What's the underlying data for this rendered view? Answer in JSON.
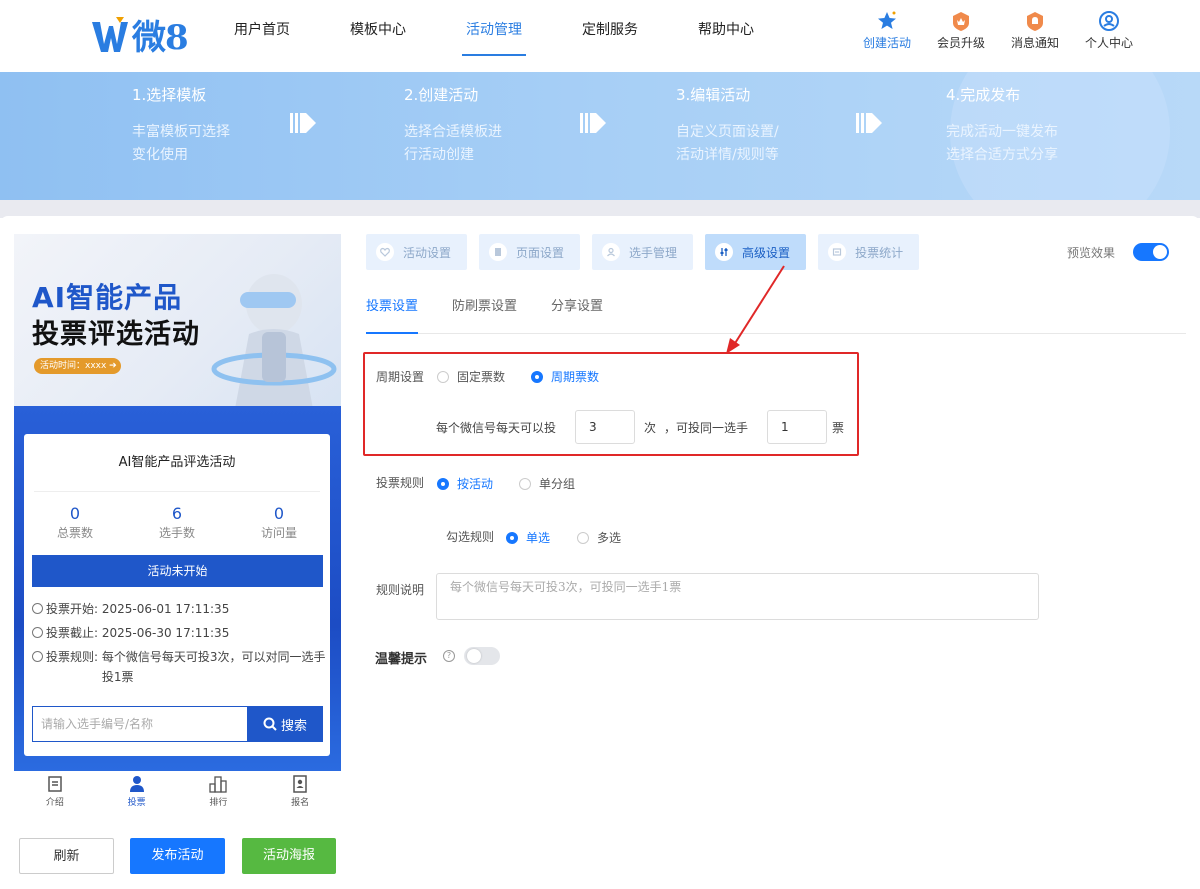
{
  "logo": {
    "text": "微8"
  },
  "nav": {
    "items": [
      "用户首页",
      "模板中心",
      "活动管理",
      "定制服务",
      "帮助中心"
    ],
    "active_index": 2
  },
  "tools": {
    "create": "创建活动",
    "upgrade": "会员升级",
    "notice": "消息通知",
    "profile": "个人中心"
  },
  "steps": [
    {
      "title": "1.选择模板",
      "desc1": "丰富模板可选择",
      "desc2": "变化使用"
    },
    {
      "title": "2.创建活动",
      "desc1": "选择合适模板进",
      "desc2": "行活动创建"
    },
    {
      "title": "3.编辑活动",
      "desc1": "自定义页面设置/",
      "desc2": "活动详情/规则等"
    },
    {
      "title": "4.完成发布",
      "desc1": "完成活动一键发布",
      "desc2": "选择合适方式分享"
    }
  ],
  "preview_phone": {
    "poster_line1": "AI智能产品",
    "poster_line2": "投票评选活动",
    "poster_time": "活动时间：xxxx",
    "activity_title": "AI智能产品评选活动",
    "stats": [
      {
        "num": "0",
        "label": "总票数"
      },
      {
        "num": "6",
        "label": "选手数"
      },
      {
        "num": "0",
        "label": "访问量"
      }
    ],
    "status": "活动未开始",
    "start_label": "投票开始:",
    "start_value": "2025-06-01 17:11:35",
    "end_label": "投票截止:",
    "end_value": "2025-06-30 17:11:35",
    "rule_label": "投票规则:",
    "rule_value": "每个微信号每天可投3次，可以对同一选手投1票",
    "search_placeholder": "请输入选手编号/名称",
    "search_button": "搜索",
    "tabs": [
      "介绍",
      "投票",
      "排行",
      "报名"
    ],
    "active_tab": 1
  },
  "actions": {
    "refresh": "刷新",
    "publish": "发布活动",
    "poster": "活动海报"
  },
  "settings_tabs": [
    "活动设置",
    "页面设置",
    "选手管理",
    "高级设置",
    "投票统计"
  ],
  "settings_active": 3,
  "preview_label": "预览效果",
  "preview_enabled": true,
  "sub_tabs": [
    "投票设置",
    "防刷票设置",
    "分享设置"
  ],
  "sub_active": 0,
  "form": {
    "period_label": "周期设置",
    "period_options": [
      "固定票数",
      "周期票数"
    ],
    "period_selected": "周期票数",
    "per_day_prefix": "每个微信号每天可以投",
    "per_day_value": "3",
    "per_day_unit": "次",
    "same_player_prefix": "，可投同一选手",
    "same_player_value": "1",
    "same_player_unit": "票",
    "rule_label": "投票规则",
    "rule_options": [
      "按活动",
      "单分组"
    ],
    "rule_selected": "按活动",
    "select_label": "勾选规则",
    "select_options": [
      "单选",
      "多选"
    ],
    "select_selected": "单选",
    "desc_label": "规则说明",
    "desc_placeholder": "每个微信号每天可投3次，可投同一选手1票",
    "tip_label": "温馨提示",
    "tip_enabled": false
  },
  "colors": {
    "accent": "#1677ff",
    "highlight": "#e02828",
    "green": "#56b941",
    "banner": "#a7cff6"
  }
}
